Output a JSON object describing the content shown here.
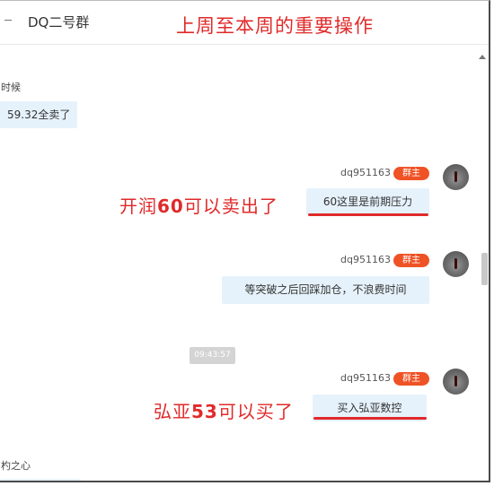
{
  "header": {
    "group_name": "DQ二号群",
    "overlay_title": "上周至本周的重要操作"
  },
  "messages": {
    "left_1_sender_fragment": "时候",
    "left_1_text": "59.32全卖了",
    "right_1_sender": "dq951163",
    "right_1_badge": "群主",
    "right_1_text": "60这里是前期压力",
    "right_2_sender": "dq951163",
    "right_2_badge": "群主",
    "right_2_text": "等突破之后回踩加仓，不浪费时间",
    "timestamp": "09:43:57",
    "right_3_sender": "dq951163",
    "right_3_badge": "群主",
    "right_3_text": "买入弘亚数控",
    "left_2_sender_fragment": "杓之心"
  },
  "annotations": {
    "note_1_prefix": "开润",
    "note_1_number": "60",
    "note_1_suffix": "可以卖出了",
    "note_2_prefix": "弘亚",
    "note_2_number": "53",
    "note_2_suffix": "可以买了"
  },
  "colors": {
    "annotation_red": "#e02a2a",
    "badge_orange": "#ef5225",
    "bubble_blue": "#e6f2fb"
  }
}
